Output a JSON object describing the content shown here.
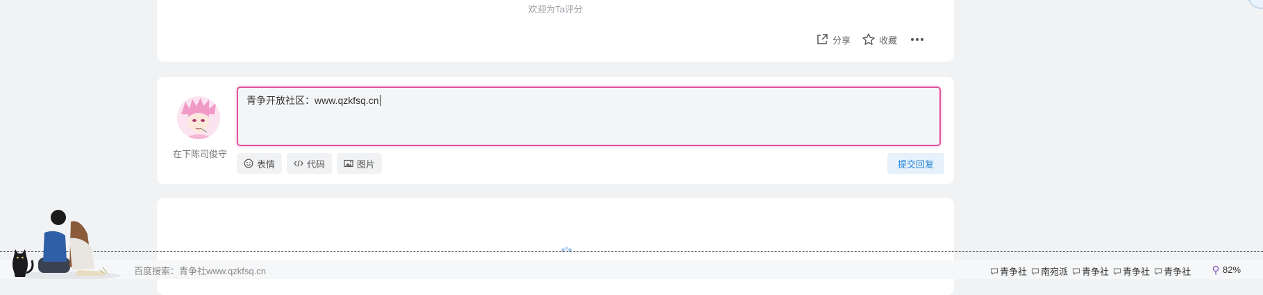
{
  "post": {
    "welcome": "欢迎为Ta评分",
    "share": "分享",
    "favorite": "收藏"
  },
  "reply": {
    "username": "在下陈司俊守",
    "editor_text": "青争开放社区：www.qzkfsq.cn",
    "tools": [
      "表情",
      "代码",
      "图片"
    ],
    "submit": "提交回复"
  },
  "footer": {
    "search_text": "百度搜索：青争社www.qzkfsq.cn",
    "links": [
      "青争社",
      "南宛派",
      "青争社",
      "青争社",
      "青争社"
    ],
    "battery": "82%"
  },
  "colors": {
    "accent_pink": "#e0529c",
    "submit_blue": "#2a86d8",
    "background": "#f1f2f4"
  }
}
